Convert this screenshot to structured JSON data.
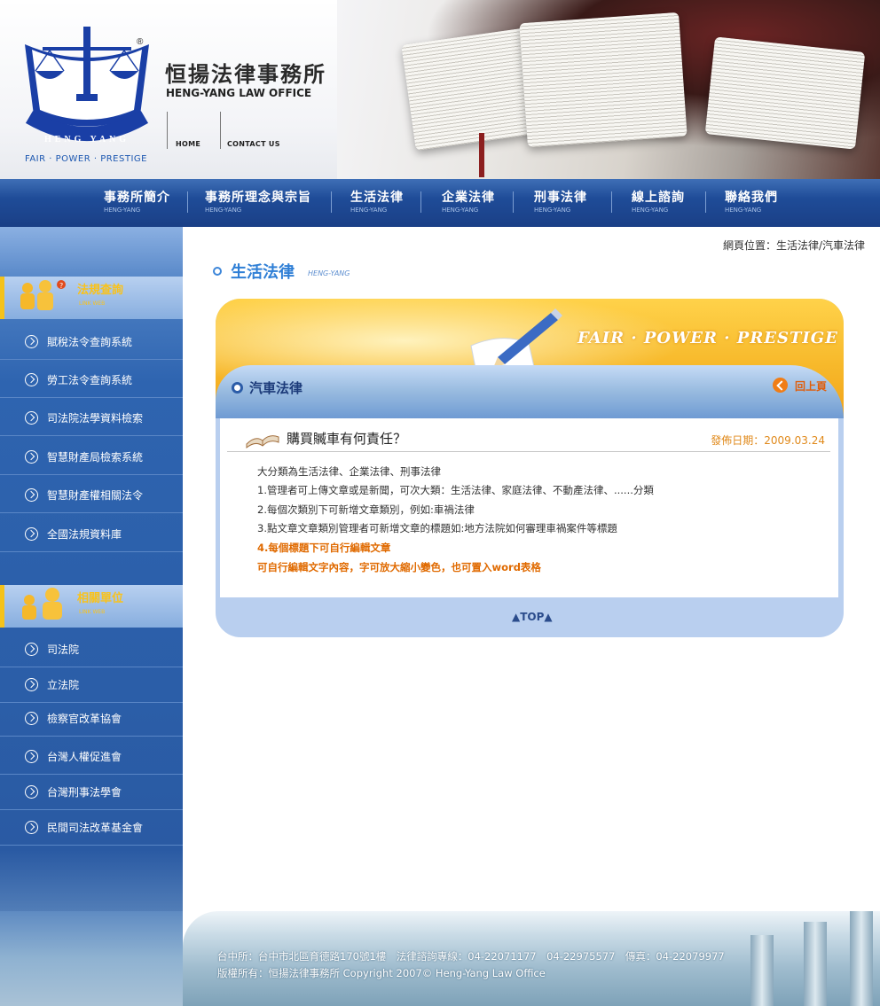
{
  "header": {
    "firm_name": "恒揚法律事務所",
    "firm_name_en": "HENG-YANG LAW OFFICE",
    "tagline": "FAIR · POWER · PRESTIGE",
    "logo_text": "HENG YANG",
    "home_link": "HOME",
    "contact_link": "CONTACT US"
  },
  "nav": {
    "items": [
      {
        "label": "事務所簡介",
        "sub": "HENG-YANG"
      },
      {
        "label": "事務所理念與宗旨",
        "sub": "HENG-YANG"
      },
      {
        "label": "生活法律",
        "sub": "HENG-YANG"
      },
      {
        "label": "企業法律",
        "sub": "HENG-YANG"
      },
      {
        "label": "刑事法律",
        "sub": "HENG-YANG"
      },
      {
        "label": "線上諮詢",
        "sub": "HENG-YANG"
      },
      {
        "label": "聯絡我們",
        "sub": "HENG-YANG"
      }
    ]
  },
  "sidebar": {
    "section1": {
      "title": "法規查詢",
      "sub": "LINK WEB",
      "items": [
        "賦稅法令查詢系統",
        "勞工法令查詢系統",
        "司法院法學資料檢索",
        "智慧財產局檢索系統",
        "智慧財產權相關法令",
        "全國法規資料庫"
      ]
    },
    "section2": {
      "title": "相關單位",
      "sub": "LINK WEB",
      "items": [
        "司法院",
        "立法院",
        "檢察官改革協會",
        "台灣人權促進會",
        "台灣刑事法學會",
        "民間司法改革基金會"
      ]
    }
  },
  "main": {
    "breadcrumb": "網頁位置：生活法律/汽車法律",
    "section_title": "生活法律",
    "section_sub": "HENG-YANG",
    "banner_text": "FAIR · POWER · PRESTIGE",
    "sub_title": "汽車法律",
    "back_label": "回上頁",
    "article": {
      "title": "購買贓車有何責任？",
      "date": "發佈日期：2009.03.24",
      "lines": [
        "大分類為生活法律、企業法律、刑事法律",
        "1.管理者可上傳文章或是新聞，可次大類：生活法律、家庭法律、不動產法律、......分類",
        "2.每個次類別下可新增文章類別，例如:車禍法律",
        "3.點文章文章類別管理者可新增文章的標題如:地方法院如何審理車禍案件等標題"
      ],
      "highlight_lines": [
        "4.每個標題下可自行編輯文章",
        "可自行編輯文字內容，字可放大縮小變色，也可置入word表格"
      ]
    },
    "top_label": "▲TOP▲"
  },
  "footer": {
    "line1": "台中所：台中市北區育德路170號1樓　法律諮詢專線：04-22071177　04-22975577　傳真：04-22079977",
    "line2": "版權所有：恒揚法律事務所  Copyright 2007© Heng-Yang Law Office"
  },
  "colors": {
    "nav_blue": "#1f4c98",
    "accent_orange": "#e06a00",
    "title_blue": "#2f7fd6",
    "sidebar_yellow": "#f9c21b"
  }
}
